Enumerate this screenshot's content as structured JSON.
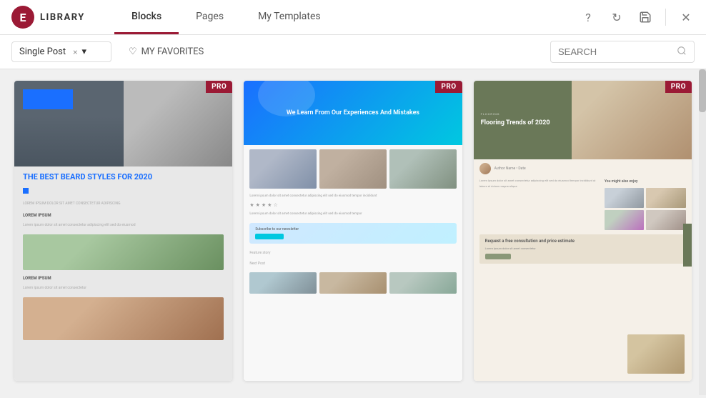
{
  "header": {
    "logo_letter": "E",
    "logo_text": "LIBRARY",
    "tabs": [
      {
        "id": "blocks",
        "label": "Blocks",
        "active": true
      },
      {
        "id": "pages",
        "label": "Pages",
        "active": false
      },
      {
        "id": "my-templates",
        "label": "My Templates",
        "active": false
      }
    ],
    "actions": {
      "help": "?",
      "refresh": "↻",
      "save": "💾",
      "close": "✕"
    }
  },
  "toolbar": {
    "dropdown_value": "Single Post",
    "dropdown_clear": "×",
    "favorites_label": "MY FAVORITES",
    "search_placeholder": "SEARCH"
  },
  "cards": [
    {
      "id": "card1",
      "pro": true,
      "pro_label": "PRO",
      "title": "The Best Beard Styles For 2020"
    },
    {
      "id": "card2",
      "pro": true,
      "pro_label": "PRO",
      "title": "We Learn From Our Experiences And Mistakes"
    },
    {
      "id": "card3",
      "pro": true,
      "pro_label": "PRO",
      "title": "Flooring Trends of 2020"
    }
  ],
  "icons": {
    "heart": "♡",
    "search": "🔍",
    "chevron_down": "▾",
    "question": "?",
    "refresh": "↻",
    "close": "✕"
  }
}
